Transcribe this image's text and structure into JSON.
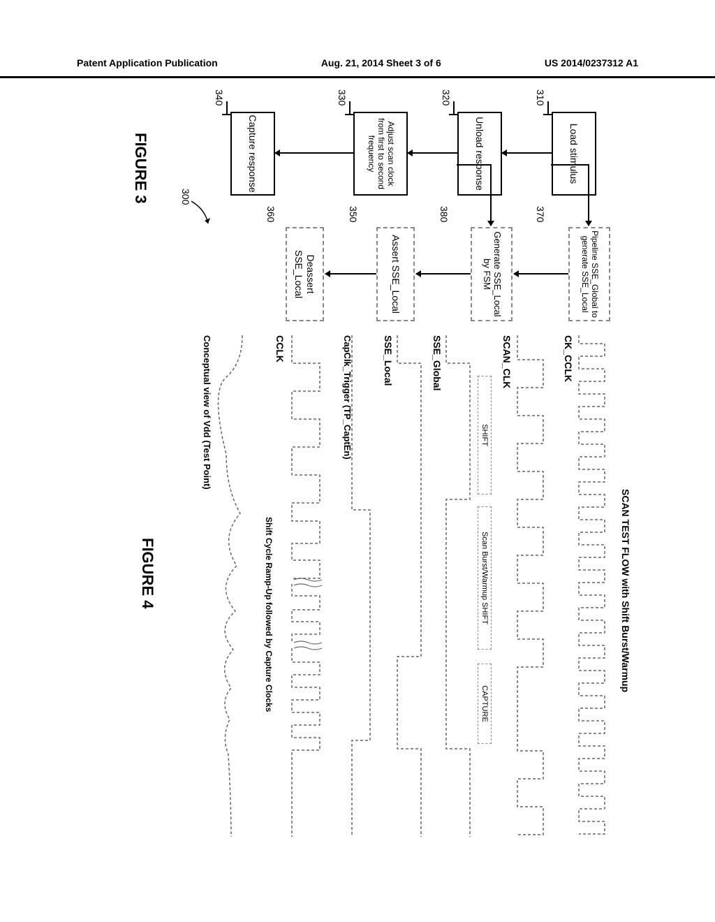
{
  "header": {
    "left": "Patent Application Publication",
    "center": "Aug. 21, 2014  Sheet 3 of 6",
    "right": "US 2014/0237312 A1"
  },
  "fig3": {
    "label": "FIGURE 3",
    "ref300": "300",
    "blocks": {
      "b310": {
        "text": "Load stimulus",
        "ref": "310"
      },
      "b320": {
        "text": "Unload response",
        "ref": "320"
      },
      "b330": {
        "text": "Adjust scan clock from first to second frequency",
        "ref": "330"
      },
      "b340": {
        "text": "Capture response",
        "ref": "340"
      },
      "b370": {
        "text": "Pipeline SSE_Global to generate SSE_Local",
        "ref": "370"
      },
      "b380": {
        "text": "Generate SSE_Local by FSM",
        "ref": "380"
      },
      "b350": {
        "text": "Assert SSE_Local",
        "ref": "350"
      },
      "b360": {
        "text": "Deassert SSE_Local",
        "ref": "360"
      }
    }
  },
  "fig4": {
    "label": "FIGURE 4",
    "title": "SCAN TEST FLOW with Shift Burst/Warmup",
    "signals": {
      "ck_cclk": "CK_CCLK",
      "scan_clk": "SCAN_CLK",
      "sse_global": "SSE_Global",
      "sse_local": "SSE_Local",
      "capclk": "CapClk_Trigger (TP_CaptEn)",
      "cclk": "CCLK",
      "vdd": "Conceptual view of Vdd (Test Point)"
    },
    "phases": {
      "shift": "SHIFT",
      "burst": "Scan Burst/Warmup SHIFT",
      "capture": "CAPTURE"
    },
    "annot": {
      "rampup": "Shift Cycle Ramp-Up followed by Capture Clocks"
    }
  }
}
